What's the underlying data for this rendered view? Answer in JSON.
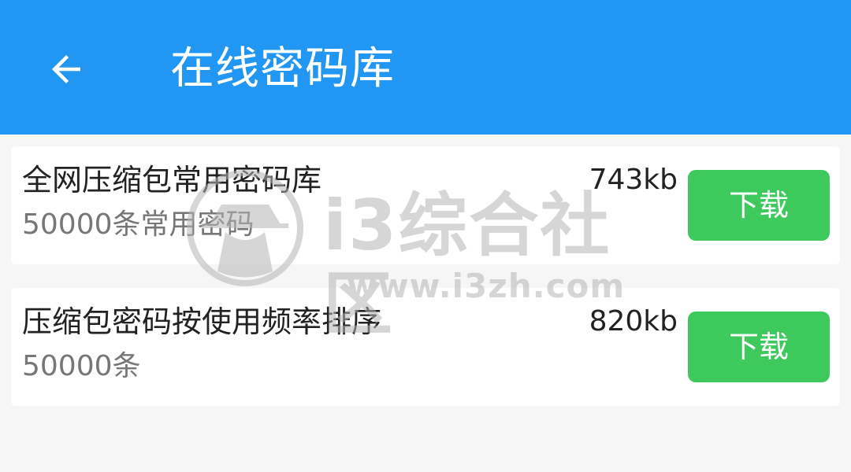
{
  "header": {
    "title": "在线密码库",
    "background_color": "#2196f3",
    "back_icon": "arrow-back-icon"
  },
  "items": [
    {
      "name": "全网压缩包常用密码库",
      "description": "50000条常用密码",
      "size": "743kb",
      "button_label": "下载"
    },
    {
      "name": "压缩包密码按使用频率排序",
      "description": "50000条",
      "size": "820kb",
      "button_label": "下载"
    }
  ],
  "watermark": {
    "text": "i3综合社区",
    "url": "www.i3zh.com"
  },
  "colors": {
    "accent": "#2196f3",
    "button": "#3ec95c"
  }
}
